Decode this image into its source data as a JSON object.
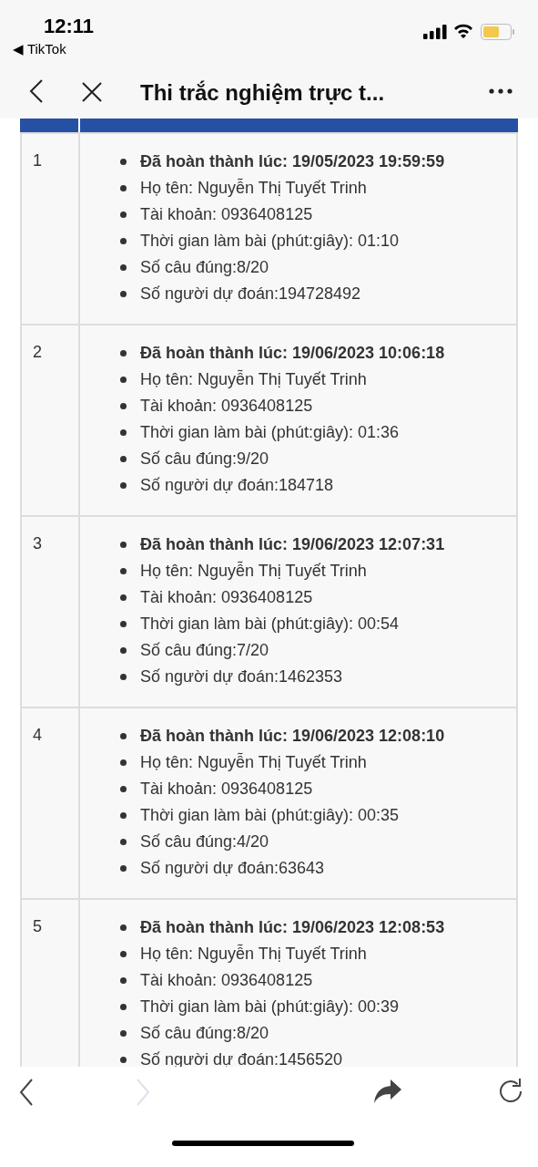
{
  "status_bar": {
    "time": "12:11",
    "back_app": "◀ TikTok"
  },
  "nav": {
    "title": "Thi trắc nghiệm trực t..."
  },
  "rows": [
    {
      "index": "1",
      "items": [
        {
          "text": "Đã hoàn thành lúc: 19/05/2023 19:59:59",
          "bold": true
        },
        {
          "text": "Họ tên: Nguyễn Thị Tuyết Trinh",
          "bold": false
        },
        {
          "text": "Tài khoản: 0936408125",
          "bold": false
        },
        {
          "text": "Thời gian làm bài (phút:giây): 01:10",
          "bold": false
        },
        {
          "text": "Số câu đúng:8/20",
          "bold": false
        },
        {
          "text": "Số người dự đoán:194728492",
          "bold": false
        }
      ]
    },
    {
      "index": "2",
      "items": [
        {
          "text": "Đã hoàn thành lúc: 19/06/2023 10:06:18",
          "bold": true
        },
        {
          "text": "Họ tên: Nguyễn Thị Tuyết Trinh",
          "bold": false
        },
        {
          "text": "Tài khoản: 0936408125",
          "bold": false
        },
        {
          "text": "Thời gian làm bài (phút:giây): 01:36",
          "bold": false
        },
        {
          "text": "Số câu đúng:9/20",
          "bold": false
        },
        {
          "text": "Số người dự đoán:184718",
          "bold": false
        }
      ]
    },
    {
      "index": "3",
      "items": [
        {
          "text": "Đã hoàn thành lúc: 19/06/2023 12:07:31",
          "bold": true
        },
        {
          "text": "Họ tên: Nguyễn Thị Tuyết Trinh",
          "bold": false
        },
        {
          "text": "Tài khoản: 0936408125",
          "bold": false
        },
        {
          "text": "Thời gian làm bài (phút:giây): 00:54",
          "bold": false
        },
        {
          "text": "Số câu đúng:7/20",
          "bold": false
        },
        {
          "text": "Số người dự đoán:1462353",
          "bold": false
        }
      ]
    },
    {
      "index": "4",
      "items": [
        {
          "text": "Đã hoàn thành lúc: 19/06/2023 12:08:10",
          "bold": true
        },
        {
          "text": "Họ tên: Nguyễn Thị Tuyết Trinh",
          "bold": false
        },
        {
          "text": "Tài khoản: 0936408125",
          "bold": false
        },
        {
          "text": "Thời gian làm bài (phút:giây): 00:35",
          "bold": false
        },
        {
          "text": "Số câu đúng:4/20",
          "bold": false
        },
        {
          "text": "Số người dự đoán:63643",
          "bold": false
        }
      ]
    },
    {
      "index": "5",
      "items": [
        {
          "text": "Đã hoàn thành lúc: 19/06/2023 12:08:53",
          "bold": true
        },
        {
          "text": "Họ tên: Nguyễn Thị Tuyết Trinh",
          "bold": false
        },
        {
          "text": "Tài khoản: 0936408125",
          "bold": false
        },
        {
          "text": "Thời gian làm bài (phút:giây): 00:39",
          "bold": false
        },
        {
          "text": "Số câu đúng:8/20",
          "bold": false
        },
        {
          "text": "Số người dự đoán:1456520",
          "bold": false
        }
      ]
    }
  ],
  "toolbar": {
    "forward_disabled": true
  }
}
